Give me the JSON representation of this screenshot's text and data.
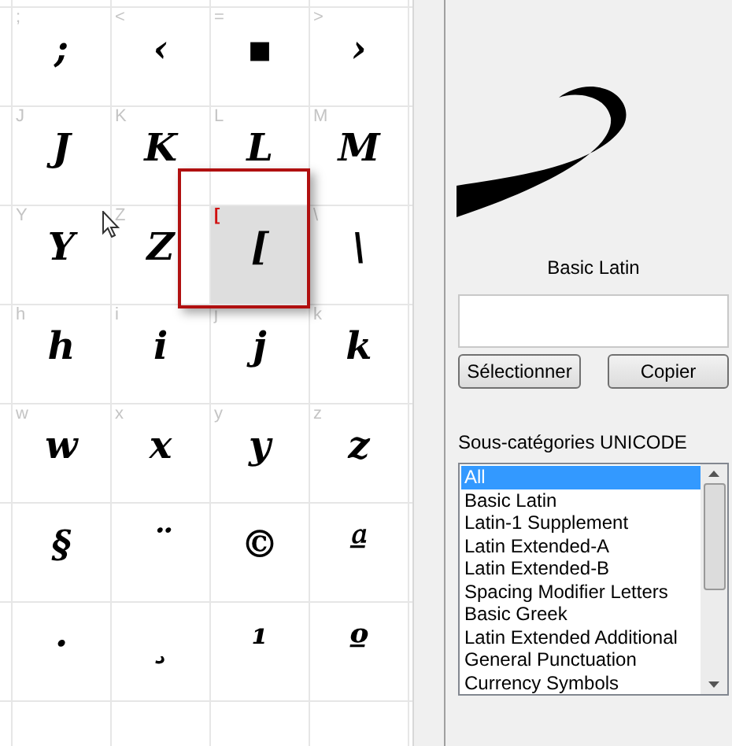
{
  "grid": {
    "rows": [
      [
        {
          "label": ";",
          "glyph": ";",
          "selected": false
        },
        {
          "label": "<",
          "glyph": "‹",
          "selected": false
        },
        {
          "label": "=",
          "glyph": "▪",
          "selected": false
        },
        {
          "label": ">",
          "glyph": "›",
          "selected": false
        }
      ],
      [
        {
          "label": "J",
          "glyph": "J",
          "selected": false
        },
        {
          "label": "K",
          "glyph": "K",
          "selected": false
        },
        {
          "label": "L",
          "glyph": "L",
          "selected": false
        },
        {
          "label": "M",
          "glyph": "M",
          "selected": false
        }
      ],
      [
        {
          "label": "Y",
          "glyph": "Y",
          "selected": false
        },
        {
          "label": "Z",
          "glyph": "Z",
          "selected": false
        },
        {
          "label": "[",
          "glyph": "[",
          "selected": true
        },
        {
          "label": "\\",
          "glyph": "\\",
          "selected": false
        }
      ],
      [
        {
          "label": "h",
          "glyph": "h",
          "selected": false
        },
        {
          "label": "i",
          "glyph": "i",
          "selected": false
        },
        {
          "label": "j",
          "glyph": "j",
          "selected": false
        },
        {
          "label": "k",
          "glyph": "k",
          "selected": false
        }
      ],
      [
        {
          "label": "w",
          "glyph": "w",
          "selected": false
        },
        {
          "label": "x",
          "glyph": "x",
          "selected": false
        },
        {
          "label": "y",
          "glyph": "y",
          "selected": false
        },
        {
          "label": "z",
          "glyph": "z",
          "selected": false
        }
      ],
      [
        {
          "glyph": "§",
          "selected": false
        },
        {
          "glyph": "¨",
          "selected": false
        },
        {
          "glyph": "©",
          "selected": false
        },
        {
          "glyph": "ª",
          "selected": false
        }
      ],
      [
        {
          "glyph": "·",
          "selected": false
        },
        {
          "glyph": "¸",
          "selected": false
        },
        {
          "glyph": "¹",
          "selected": false
        },
        {
          "glyph": "º",
          "selected": false
        }
      ]
    ]
  },
  "panel": {
    "block_name": "Basic Latin",
    "buttons": [
      "Sélectionner",
      "Copier"
    ],
    "list_label": "Sous-catégories UNICODE",
    "subcategories": [
      {
        "label": "All",
        "selected": true
      },
      {
        "label": "Basic Latin",
        "selected": false
      },
      {
        "label": "Latin-1 Supplement",
        "selected": false
      },
      {
        "label": "Latin Extended-A",
        "selected": false
      },
      {
        "label": "Latin Extended-B",
        "selected": false
      },
      {
        "label": "Spacing Modifier Letters",
        "selected": false
      },
      {
        "label": "Basic Greek",
        "selected": false
      },
      {
        "label": "Latin Extended Additional",
        "selected": false
      },
      {
        "label": "General Punctuation",
        "selected": false
      },
      {
        "label": "Currency Symbols",
        "selected": false
      }
    ]
  }
}
